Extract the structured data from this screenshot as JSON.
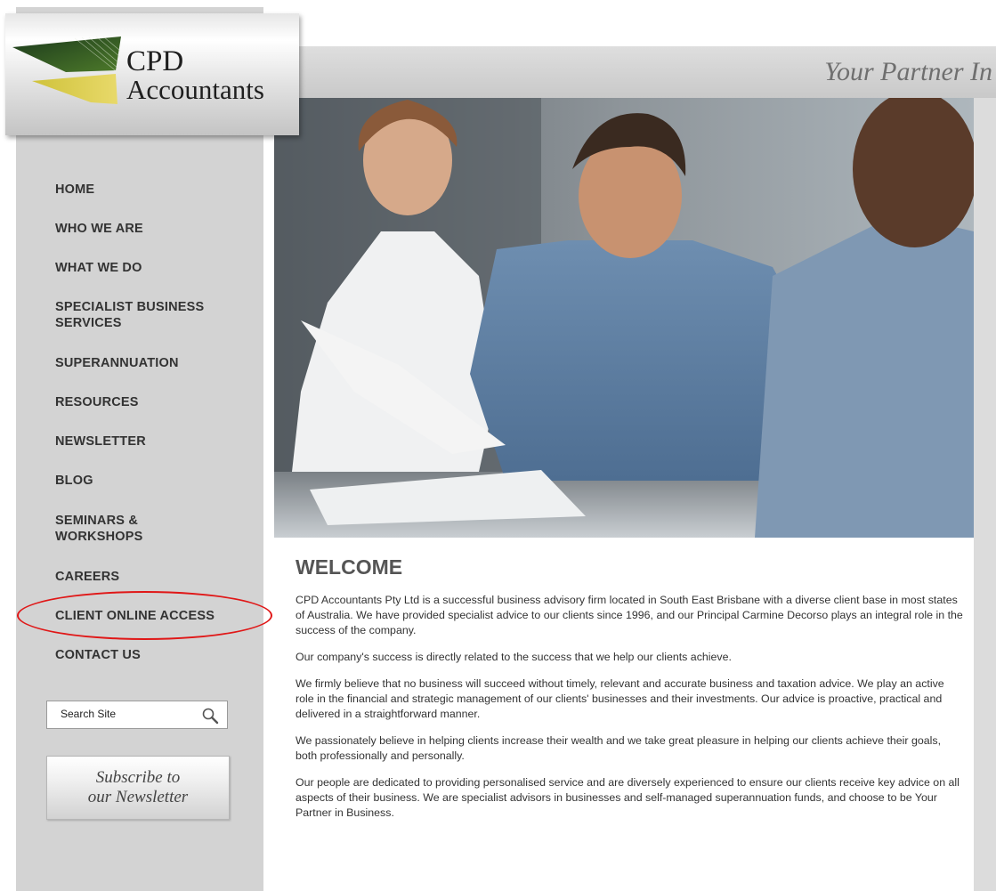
{
  "logo": {
    "line1": "CPD",
    "line2": "Accountants"
  },
  "header": {
    "tagline": "Your Partner In"
  },
  "nav": {
    "items": [
      {
        "label": "HOME"
      },
      {
        "label": "WHO WE ARE"
      },
      {
        "label": "WHAT WE DO"
      },
      {
        "label": "SPECIALIST BUSINESS SERVICES"
      },
      {
        "label": "SUPERANNUATION"
      },
      {
        "label": "RESOURCES"
      },
      {
        "label": "NEWSLETTER"
      },
      {
        "label": "BLOG"
      },
      {
        "label": "SEMINARS & WORKSHOPS"
      },
      {
        "label": "CAREERS"
      },
      {
        "label": "CLIENT ONLINE ACCESS"
      },
      {
        "label": "CONTACT US"
      }
    ]
  },
  "search": {
    "placeholder": "Search Site",
    "icon": "search-icon"
  },
  "subscribe": {
    "line1": "Subscribe to",
    "line2": "our Newsletter"
  },
  "main": {
    "heading": "WELCOME",
    "paragraphs": [
      "CPD Accountants Pty Ltd is a successful business advisory firm located in South East Brisbane with a diverse client base in most states of Australia. We have provided specialist advice to our clients since 1996, and our Principal Carmine Decorso plays an integral role in the success of the company.",
      "Our company's success is directly related to the success that we help our clients achieve.",
      "We firmly believe that no business will succeed without timely, relevant and accurate business and taxation advice. We play an active role in the financial and strategic management of our clients' businesses and their investments. Our advice is proactive, practical and delivered in a straightforward manner.",
      "We passionately believe in helping clients increase their wealth and we take great pleasure in helping our clients achieve their goals, both professionally and personally.",
      "Our people are dedicated to providing personalised service and are diversely experienced to ensure our clients receive key advice on all aspects of their business. We are specialist advisors in businesses and self-managed superannuation funds, and choose to be Your Partner in Business."
    ]
  },
  "annotation": {
    "highlight_color": "#e01717",
    "highlighted_item": "CLIENT ONLINE ACCESS"
  }
}
